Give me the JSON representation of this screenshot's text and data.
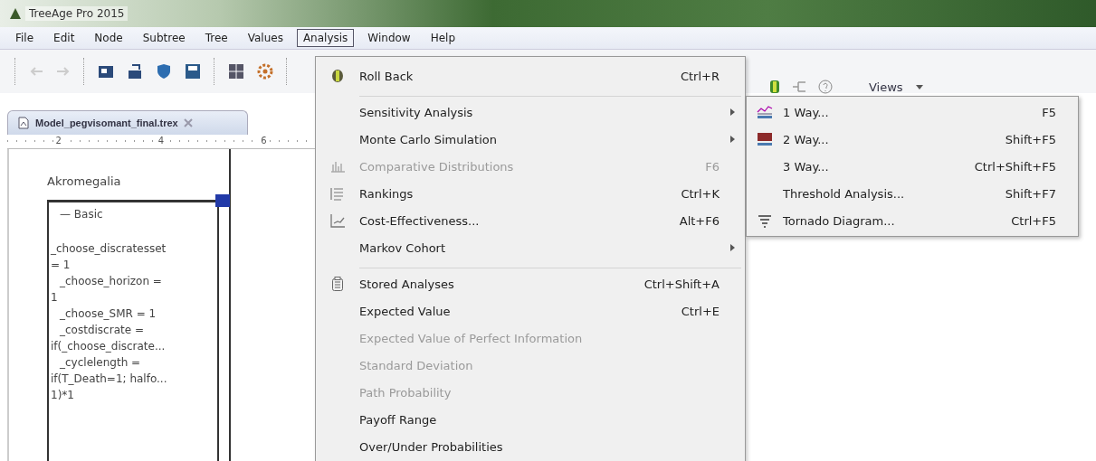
{
  "window": {
    "title": "TreeAge Pro 2015"
  },
  "menubar": [
    {
      "label": "File",
      "selected": false
    },
    {
      "label": "Edit",
      "selected": false
    },
    {
      "label": "Node",
      "selected": false
    },
    {
      "label": "Subtree",
      "selected": false
    },
    {
      "label": "Tree",
      "selected": false
    },
    {
      "label": "Values",
      "selected": false
    },
    {
      "label": "Analysis",
      "selected": true
    },
    {
      "label": "Window",
      "selected": false
    },
    {
      "label": "Help",
      "selected": false
    }
  ],
  "toolbar": {
    "views_label": "Views"
  },
  "editor_tab": {
    "label": "Model_pegvisomant_final.trex"
  },
  "ruler": {
    "labels": [
      "2",
      "4",
      "6"
    ]
  },
  "tree": {
    "root_label": "Akromegalia",
    "heading": "— Basic",
    "lines": [
      {
        "text": "_choose_discratesset",
        "indented": false
      },
      {
        "text": "= 1",
        "indented": false
      },
      {
        "text": "_choose_horizon =",
        "indented": true
      },
      {
        "text": "1",
        "indented": false
      },
      {
        "text": "_choose_SMR = 1",
        "indented": true
      },
      {
        "text": "_costdiscrate =",
        "indented": true
      },
      {
        "text": "if(_choose_discrate...",
        "indented": false
      },
      {
        "text": "_cyclelength =",
        "indented": true
      },
      {
        "text": "if(T_Death=1; halfo...",
        "indented": false
      },
      {
        "text": "1)*1",
        "indented": false
      }
    ]
  },
  "analysis_menu": {
    "items": [
      {
        "label": "Roll Back",
        "shortcut": "Ctrl+R",
        "disabled": false,
        "submenu": false,
        "kind": "rollback",
        "separator_after": true
      },
      {
        "label": "Sensitivity Analysis",
        "disabled": false,
        "submenu": true,
        "kind": "plain",
        "separator_after": false
      },
      {
        "label": "Monte Carlo Simulation",
        "disabled": false,
        "submenu": true,
        "kind": "plain",
        "separator_after": false
      },
      {
        "label": "Comparative Distributions",
        "shortcut": "F6",
        "disabled": true,
        "submenu": false,
        "kind": "distribution",
        "separator_after": false
      },
      {
        "label": "Rankings",
        "shortcut": "Ctrl+K",
        "disabled": false,
        "submenu": false,
        "kind": "rankings",
        "separator_after": false
      },
      {
        "label": "Cost-Effectiveness...",
        "shortcut": "Alt+F6",
        "disabled": false,
        "submenu": false,
        "kind": "scatter",
        "separator_after": false
      },
      {
        "label": "Markov Cohort",
        "disabled": false,
        "submenu": true,
        "kind": "plain",
        "separator_after": true
      },
      {
        "label": "Stored Analyses",
        "shortcut": "Ctrl+Shift+A",
        "disabled": false,
        "submenu": false,
        "kind": "clipboard",
        "separator_after": false
      },
      {
        "label": "Expected Value",
        "shortcut": "Ctrl+E",
        "disabled": false,
        "submenu": false,
        "kind": "plain",
        "separator_after": false
      },
      {
        "label": "Expected Value of Perfect Information",
        "disabled": true,
        "submenu": false,
        "kind": "plain",
        "separator_after": false
      },
      {
        "label": "Standard Deviation",
        "disabled": true,
        "submenu": false,
        "kind": "plain",
        "separator_after": false
      },
      {
        "label": "Path Probability",
        "disabled": true,
        "submenu": false,
        "kind": "plain",
        "separator_after": false
      },
      {
        "label": "Payoff Range",
        "disabled": false,
        "submenu": false,
        "kind": "plain",
        "separator_after": false
      },
      {
        "label": "Over/Under Probabilities",
        "disabled": false,
        "submenu": false,
        "kind": "plain",
        "separator_after": false
      }
    ]
  },
  "sensitivity_submenu": {
    "items": [
      {
        "label": "1 Way...",
        "shortcut": "F5",
        "kind": "line-chart"
      },
      {
        "label": "2 Way...",
        "shortcut": "Shift+F5",
        "kind": "grid-chart"
      },
      {
        "label": "3 Way...",
        "shortcut": "Ctrl+Shift+F5",
        "kind": "plain"
      },
      {
        "label": "Threshold Analysis...",
        "shortcut": "Shift+F7",
        "kind": "plain"
      },
      {
        "label": "Tornado Diagram...",
        "shortcut": "Ctrl+F5",
        "kind": "tornado"
      }
    ]
  }
}
